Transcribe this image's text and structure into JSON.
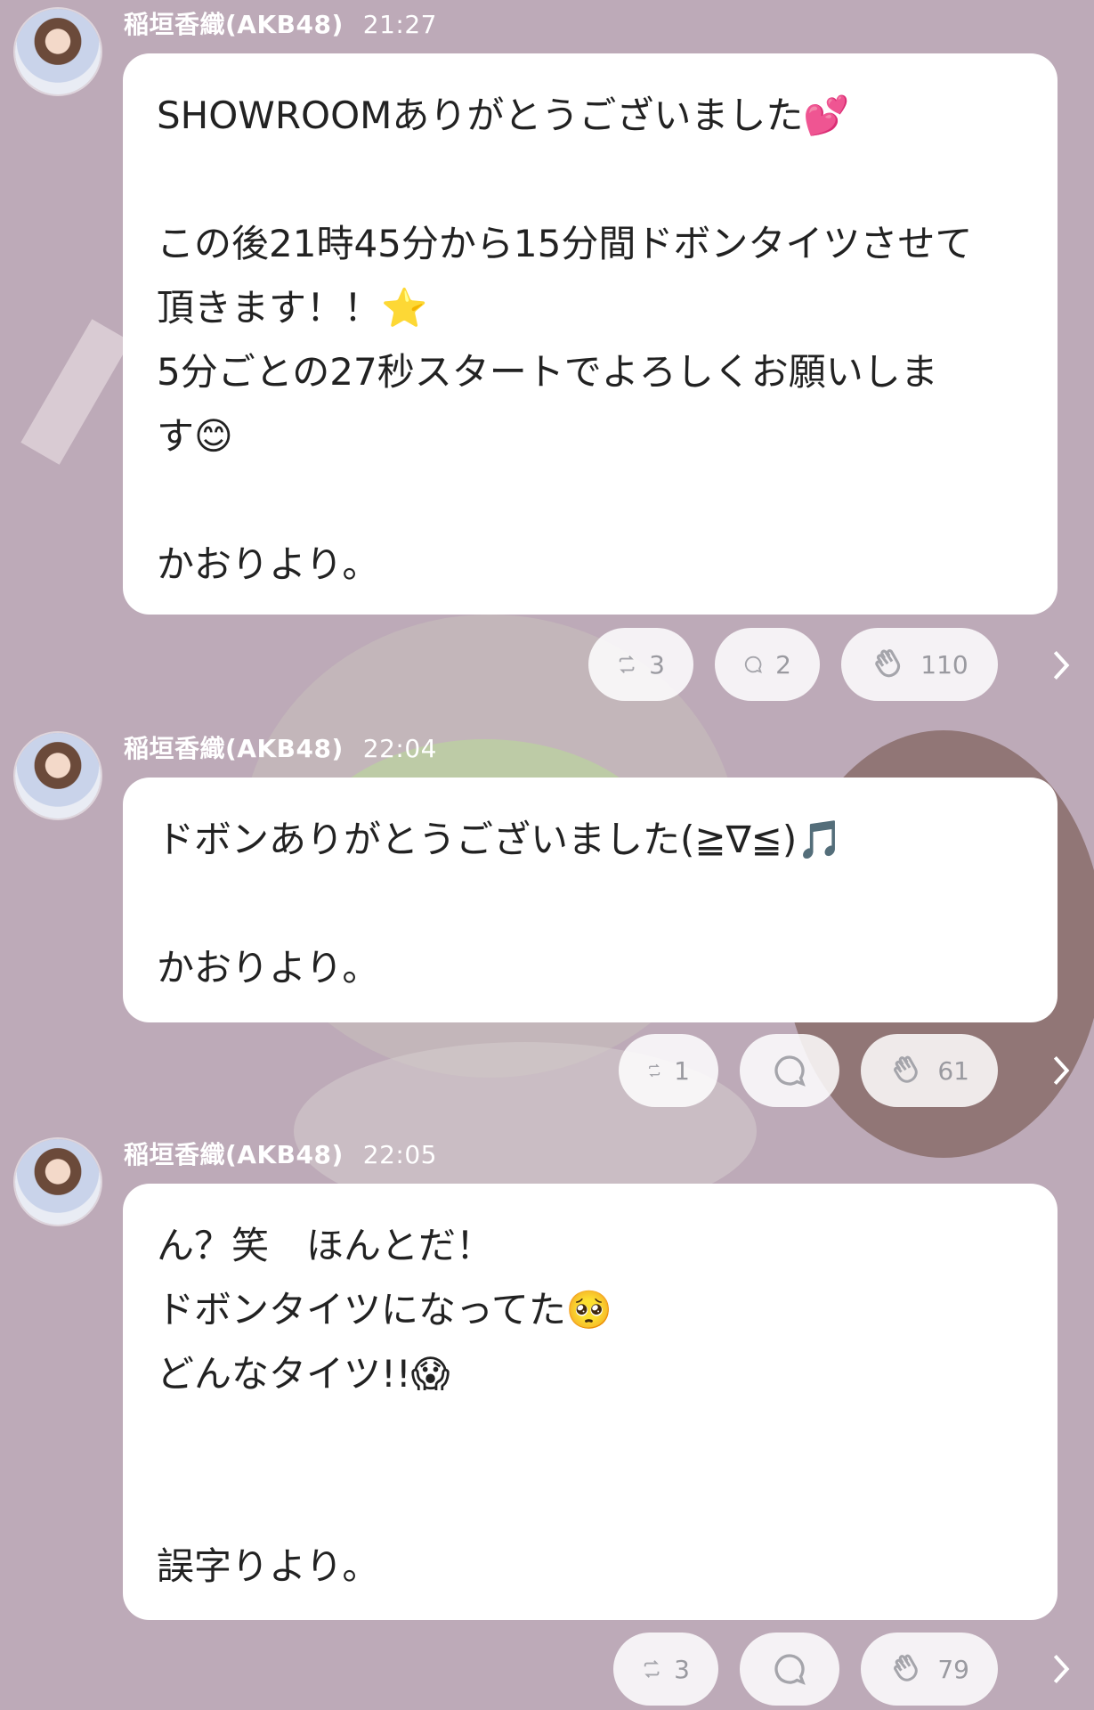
{
  "posts": [
    {
      "author": "稲垣香織(AKB48)",
      "time": "21:27",
      "lines": [
        "SHOWROOMありがとうございました💕",
        "",
        "この後21時45分から15分間ドボンタイツさせて",
        "頂きます！！⭐",
        "5分ごとの27秒スタートでよろしくお願いしま",
        "す😊",
        "",
        "かおりより。"
      ],
      "retweet_count": "3",
      "comment_count": "2",
      "clap_count": "110"
    },
    {
      "author": "稲垣香織(AKB48)",
      "time": "22:04",
      "lines": [
        "ドボンありがとうございました(≧∇≦)🎵",
        "",
        "かおりより。"
      ],
      "retweet_count": "1",
      "comment_count": "",
      "clap_count": "61"
    },
    {
      "author": "稲垣香織(AKB48)",
      "time": "22:05",
      "lines": [
        "ん？笑　ほんとだ！",
        "ドボンタイツになってた🥺",
        "どんなタイツ!!😱",
        "",
        "",
        "誤字りより。"
      ],
      "retweet_count": "3",
      "comment_count": "",
      "clap_count": "79"
    }
  ],
  "icons": {
    "retweet": "retweet-icon",
    "comment": "comment-icon",
    "clap": "clap-icon",
    "more": "chevron-right-icon"
  },
  "colors": {
    "background": "#bdaab8",
    "bubble": "#ffffff",
    "meta_text": "#ffffff",
    "pill_text": "#9a9aa0"
  }
}
